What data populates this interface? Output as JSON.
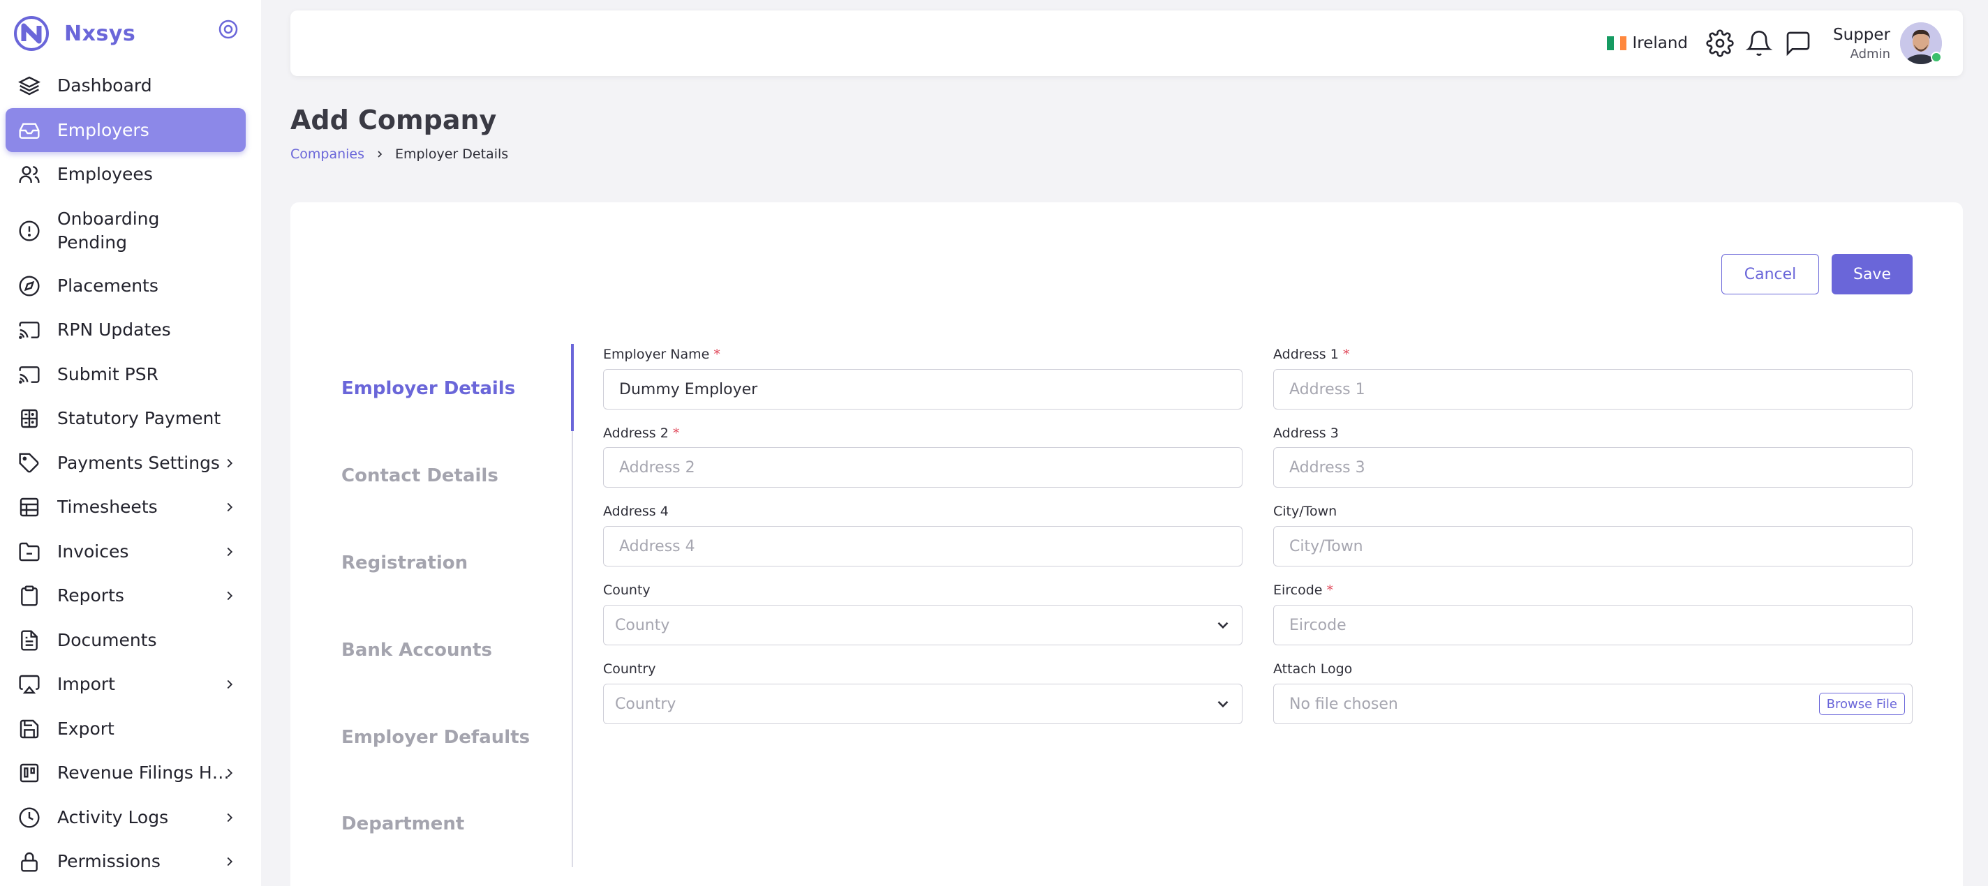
{
  "brand": {
    "name": "Nxsys"
  },
  "sidebar": {
    "items": [
      {
        "label": "Dashboard",
        "icon": "layers-icon"
      },
      {
        "label": "Employers",
        "icon": "inbox-icon",
        "active": true
      },
      {
        "label": "Employees",
        "icon": "users-icon"
      },
      {
        "label": "Onboarding Pending",
        "icon": "alert-circle-icon"
      },
      {
        "label": "Placements",
        "icon": "compass-icon"
      },
      {
        "label": "RPN Updates",
        "icon": "cast-icon"
      },
      {
        "label": "Submit PSR",
        "icon": "cast-icon"
      },
      {
        "label": "Statutory Payment",
        "icon": "calculator-icon"
      },
      {
        "label": "Payments Settings",
        "icon": "tag-icon",
        "has_children": true
      },
      {
        "label": "Timesheets",
        "icon": "table-icon",
        "has_children": true
      },
      {
        "label": "Invoices",
        "icon": "folder-minus-icon",
        "has_children": true
      },
      {
        "label": "Reports",
        "icon": "clipboard-icon",
        "has_children": true
      },
      {
        "label": "Documents",
        "icon": "file-text-icon"
      },
      {
        "label": "Import",
        "icon": "monitor-icon",
        "has_children": true
      },
      {
        "label": "Export",
        "icon": "save-icon"
      },
      {
        "label": "Revenue Filings His...",
        "icon": "trello-icon",
        "has_children": true
      },
      {
        "label": "Activity Logs",
        "icon": "clock-icon",
        "has_children": true
      },
      {
        "label": "Permissions",
        "icon": "lock-icon",
        "has_children": true
      }
    ]
  },
  "topbar": {
    "country": "Ireland",
    "user_name": "Supper",
    "user_role": "Admin"
  },
  "page": {
    "title": "Add Company",
    "breadcrumb": {
      "link": "Companies",
      "current": "Employer Details"
    }
  },
  "actions": {
    "cancel": "Cancel",
    "save": "Save"
  },
  "steps": [
    "Employer Details",
    "Contact Details",
    "Registration",
    "Bank Accounts",
    "Employer Defaults",
    "Department"
  ],
  "form": {
    "employer_name": {
      "label": "Employer Name",
      "value": "Dummy Employer"
    },
    "address1": {
      "label": "Address 1",
      "placeholder": "Address 1"
    },
    "address2": {
      "label": "Address 2",
      "placeholder": "Address 2"
    },
    "address3": {
      "label": "Address 3",
      "placeholder": "Address 3"
    },
    "address4": {
      "label": "Address 4",
      "placeholder": "Address 4"
    },
    "city": {
      "label": "City/Town",
      "placeholder": "City/Town"
    },
    "county": {
      "label": "County",
      "placeholder": "County"
    },
    "eircode": {
      "label": "Eircode",
      "placeholder": "Eircode"
    },
    "country": {
      "label": "Country",
      "placeholder": "Country"
    },
    "logo": {
      "label": "Attach Logo",
      "value": "No file chosen",
      "button": "Browse File"
    }
  },
  "colors": {
    "accent": "#6a66d9",
    "active_nav": "#8c88e8",
    "required": "#e0485a"
  }
}
